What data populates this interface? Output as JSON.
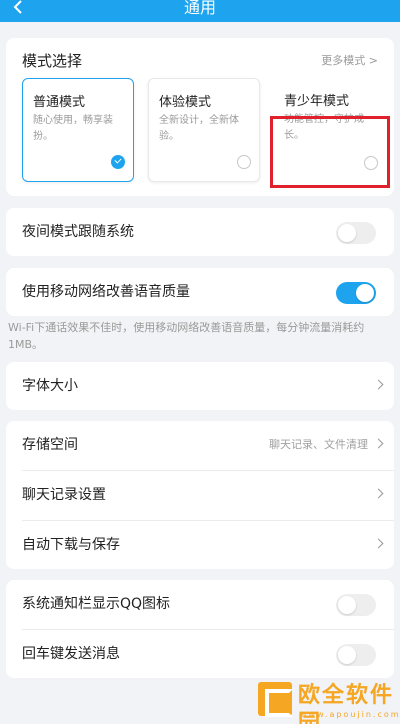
{
  "header": {
    "title": "通用"
  },
  "mode": {
    "heading": "模式选择",
    "more": "更多模式 >",
    "options": [
      {
        "name": "普通模式",
        "desc": "随心使用，畅享装扮。",
        "selected": true
      },
      {
        "name": "体验模式",
        "desc": "全新设计，全新体验。",
        "selected": false
      },
      {
        "name": "青少年模式",
        "desc": "功能管控，守护成长。",
        "selected": false
      }
    ]
  },
  "night": {
    "label": "夜间模式跟随系统",
    "on": false
  },
  "network": {
    "label": "使用移动网络改善语音质量",
    "on": true,
    "note": "Wi-Fi下通话效果不佳时，使用移动网络改善语音质量，每分钟流量消耗约1MB。"
  },
  "font": {
    "label": "字体大小"
  },
  "storage": {
    "label": "存储空间",
    "hint": "聊天记录、文件清理",
    "chat_label": "聊天记录设置",
    "download_label": "自动下载与保存"
  },
  "notify": {
    "qq_icon_label": "系统通知栏显示QQ图标",
    "qq_icon_on": false,
    "enter_label": "回车键发送消息",
    "enter_on": false
  },
  "watermark": {
    "name": "欧全软件园",
    "url": "www.apoujin.com"
  },
  "colors": {
    "accent": "#1ea4ee",
    "highlight": "#e0202a"
  }
}
